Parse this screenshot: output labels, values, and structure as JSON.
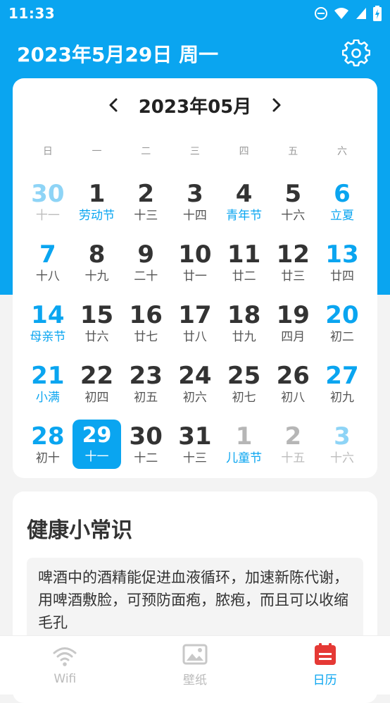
{
  "status_bar": {
    "time": "11:33"
  },
  "header": {
    "title": "2023年5月29日 周一"
  },
  "calendar": {
    "month_label": "2023年05月",
    "weekdays": [
      "日",
      "一",
      "二",
      "三",
      "四",
      "五",
      "六"
    ],
    "weeks": [
      [
        {
          "day": "30",
          "lunar": "十一",
          "style": "blue-faint",
          "lunar_style": "faint"
        },
        {
          "day": "1",
          "lunar": "劳动节",
          "style": "normal",
          "lunar_style": "blue"
        },
        {
          "day": "2",
          "lunar": "十三",
          "style": "normal",
          "lunar_style": ""
        },
        {
          "day": "3",
          "lunar": "十四",
          "style": "normal",
          "lunar_style": ""
        },
        {
          "day": "4",
          "lunar": "青年节",
          "style": "normal",
          "lunar_style": "blue"
        },
        {
          "day": "5",
          "lunar": "十六",
          "style": "normal",
          "lunar_style": ""
        },
        {
          "day": "6",
          "lunar": "立夏",
          "style": "blue",
          "lunar_style": "blue"
        }
      ],
      [
        {
          "day": "7",
          "lunar": "十八",
          "style": "blue",
          "lunar_style": ""
        },
        {
          "day": "8",
          "lunar": "十九",
          "style": "normal",
          "lunar_style": ""
        },
        {
          "day": "9",
          "lunar": "二十",
          "style": "normal",
          "lunar_style": ""
        },
        {
          "day": "10",
          "lunar": "廿一",
          "style": "normal",
          "lunar_style": ""
        },
        {
          "day": "11",
          "lunar": "廿二",
          "style": "normal",
          "lunar_style": ""
        },
        {
          "day": "12",
          "lunar": "廿三",
          "style": "normal",
          "lunar_style": ""
        },
        {
          "day": "13",
          "lunar": "廿四",
          "style": "blue",
          "lunar_style": ""
        }
      ],
      [
        {
          "day": "14",
          "lunar": "母亲节",
          "style": "blue",
          "lunar_style": "blue"
        },
        {
          "day": "15",
          "lunar": "廿六",
          "style": "normal",
          "lunar_style": ""
        },
        {
          "day": "16",
          "lunar": "廿七",
          "style": "normal",
          "lunar_style": ""
        },
        {
          "day": "17",
          "lunar": "廿八",
          "style": "normal",
          "lunar_style": ""
        },
        {
          "day": "18",
          "lunar": "廿九",
          "style": "normal",
          "lunar_style": ""
        },
        {
          "day": "19",
          "lunar": "四月",
          "style": "normal",
          "lunar_style": ""
        },
        {
          "day": "20",
          "lunar": "初二",
          "style": "blue",
          "lunar_style": ""
        }
      ],
      [
        {
          "day": "21",
          "lunar": "小满",
          "style": "blue",
          "lunar_style": "blue"
        },
        {
          "day": "22",
          "lunar": "初四",
          "style": "normal",
          "lunar_style": ""
        },
        {
          "day": "23",
          "lunar": "初五",
          "style": "normal",
          "lunar_style": ""
        },
        {
          "day": "24",
          "lunar": "初六",
          "style": "normal",
          "lunar_style": ""
        },
        {
          "day": "25",
          "lunar": "初七",
          "style": "normal",
          "lunar_style": ""
        },
        {
          "day": "26",
          "lunar": "初八",
          "style": "normal",
          "lunar_style": ""
        },
        {
          "day": "27",
          "lunar": "初九",
          "style": "blue",
          "lunar_style": ""
        }
      ],
      [
        {
          "day": "28",
          "lunar": "初十",
          "style": "blue",
          "lunar_style": ""
        },
        {
          "day": "29",
          "lunar": "十一",
          "style": "selected",
          "lunar_style": ""
        },
        {
          "day": "30",
          "lunar": "十二",
          "style": "normal",
          "lunar_style": ""
        },
        {
          "day": "31",
          "lunar": "十三",
          "style": "normal",
          "lunar_style": ""
        },
        {
          "day": "1",
          "lunar": "儿童节",
          "style": "gray-faint",
          "lunar_style": "blue"
        },
        {
          "day": "2",
          "lunar": "十五",
          "style": "gray-faint",
          "lunar_style": "faint"
        },
        {
          "day": "3",
          "lunar": "十六",
          "style": "blue-faint",
          "lunar_style": "faint"
        }
      ]
    ]
  },
  "tips": {
    "title": "健康小常识",
    "body": "啤酒中的酒精能促进血液循环，加速新陈代谢，用啤酒敷脸，可预防面疱，脓疱，而且可以收缩毛孔"
  },
  "bottom_nav": {
    "tabs": [
      {
        "label": "Wifi",
        "icon": "wifi-icon",
        "active": false
      },
      {
        "label": "壁纸",
        "icon": "image-icon",
        "active": false
      },
      {
        "label": "日历",
        "icon": "calendar-icon",
        "active": true
      }
    ]
  },
  "colors": {
    "accent": "#0aa5f0",
    "calendar_icon": "#e53935"
  }
}
